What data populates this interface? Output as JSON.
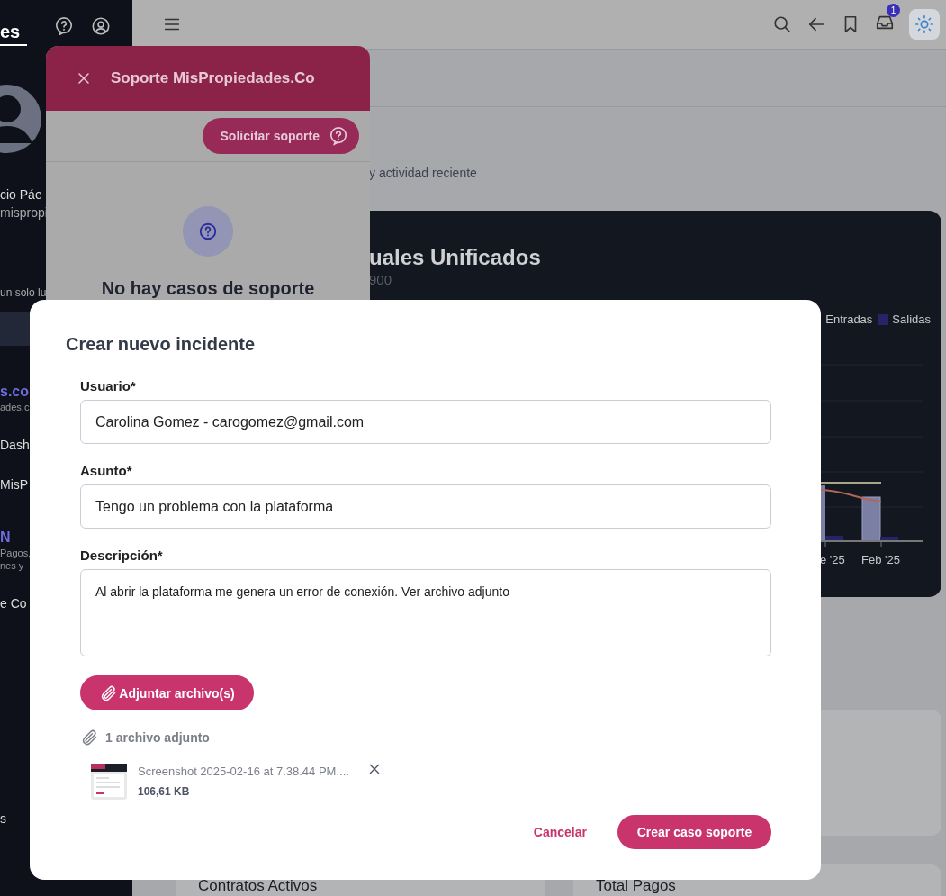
{
  "sidebar": {
    "title": "es",
    "user_name": "cio Páe",
    "user_email": "mispropi",
    "tagline": "un solo lu",
    "groups": [
      {
        "heading": "s.co",
        "notes": [
          "ades.c"
        ],
        "links": [
          "Dash",
          "MisP"
        ]
      },
      {
        "heading": "N",
        "notes": [
          "Pagos,",
          "nes y"
        ],
        "links": [
          "e Co"
        ]
      },
      {
        "links": [
          "s"
        ]
      }
    ]
  },
  "topbar": {
    "inbox_badge": "1"
  },
  "page": {
    "subtitle": "y actividad reciente",
    "chart_card": {
      "title": "uales Unificados",
      "line_1": "900",
      "legend": [
        {
          "label": "Entradas"
        },
        {
          "label": "Salidas",
          "color": "#262466"
        }
      ],
      "x_labels": [
        "e '25",
        "Feb '25"
      ]
    },
    "cards": [
      {
        "title": "Contratos Activos"
      },
      {
        "title": "Total Pagos"
      }
    ]
  },
  "drawer": {
    "title": "Soporte MisPropiedades.Co",
    "request_button": "Solicitar soporte",
    "empty_title": "No hay casos de soporte"
  },
  "modal": {
    "title": "Crear nuevo incidente",
    "fields": [
      {
        "kind": "input",
        "label": "Usuario*",
        "value": "Carolina Gomez - carogomez@gmail.com"
      },
      {
        "kind": "input",
        "label": "Asunto*",
        "value": "Tengo un problema con la plataforma"
      },
      {
        "kind": "textarea",
        "label": "Descripción*",
        "value": "Al abrir la plataforma me genera un error de conexión. Ver archivo adjunto"
      }
    ],
    "attach_button": "Adjuntar archivo(s)",
    "attachments_count": "1 archivo adjunto",
    "files": [
      {
        "name": "Screenshot 2025-02-16 at 7.38.44 PM....",
        "size": "106,61 KB"
      }
    ],
    "cancel": "Cancelar",
    "submit": "Crear caso soporte"
  }
}
